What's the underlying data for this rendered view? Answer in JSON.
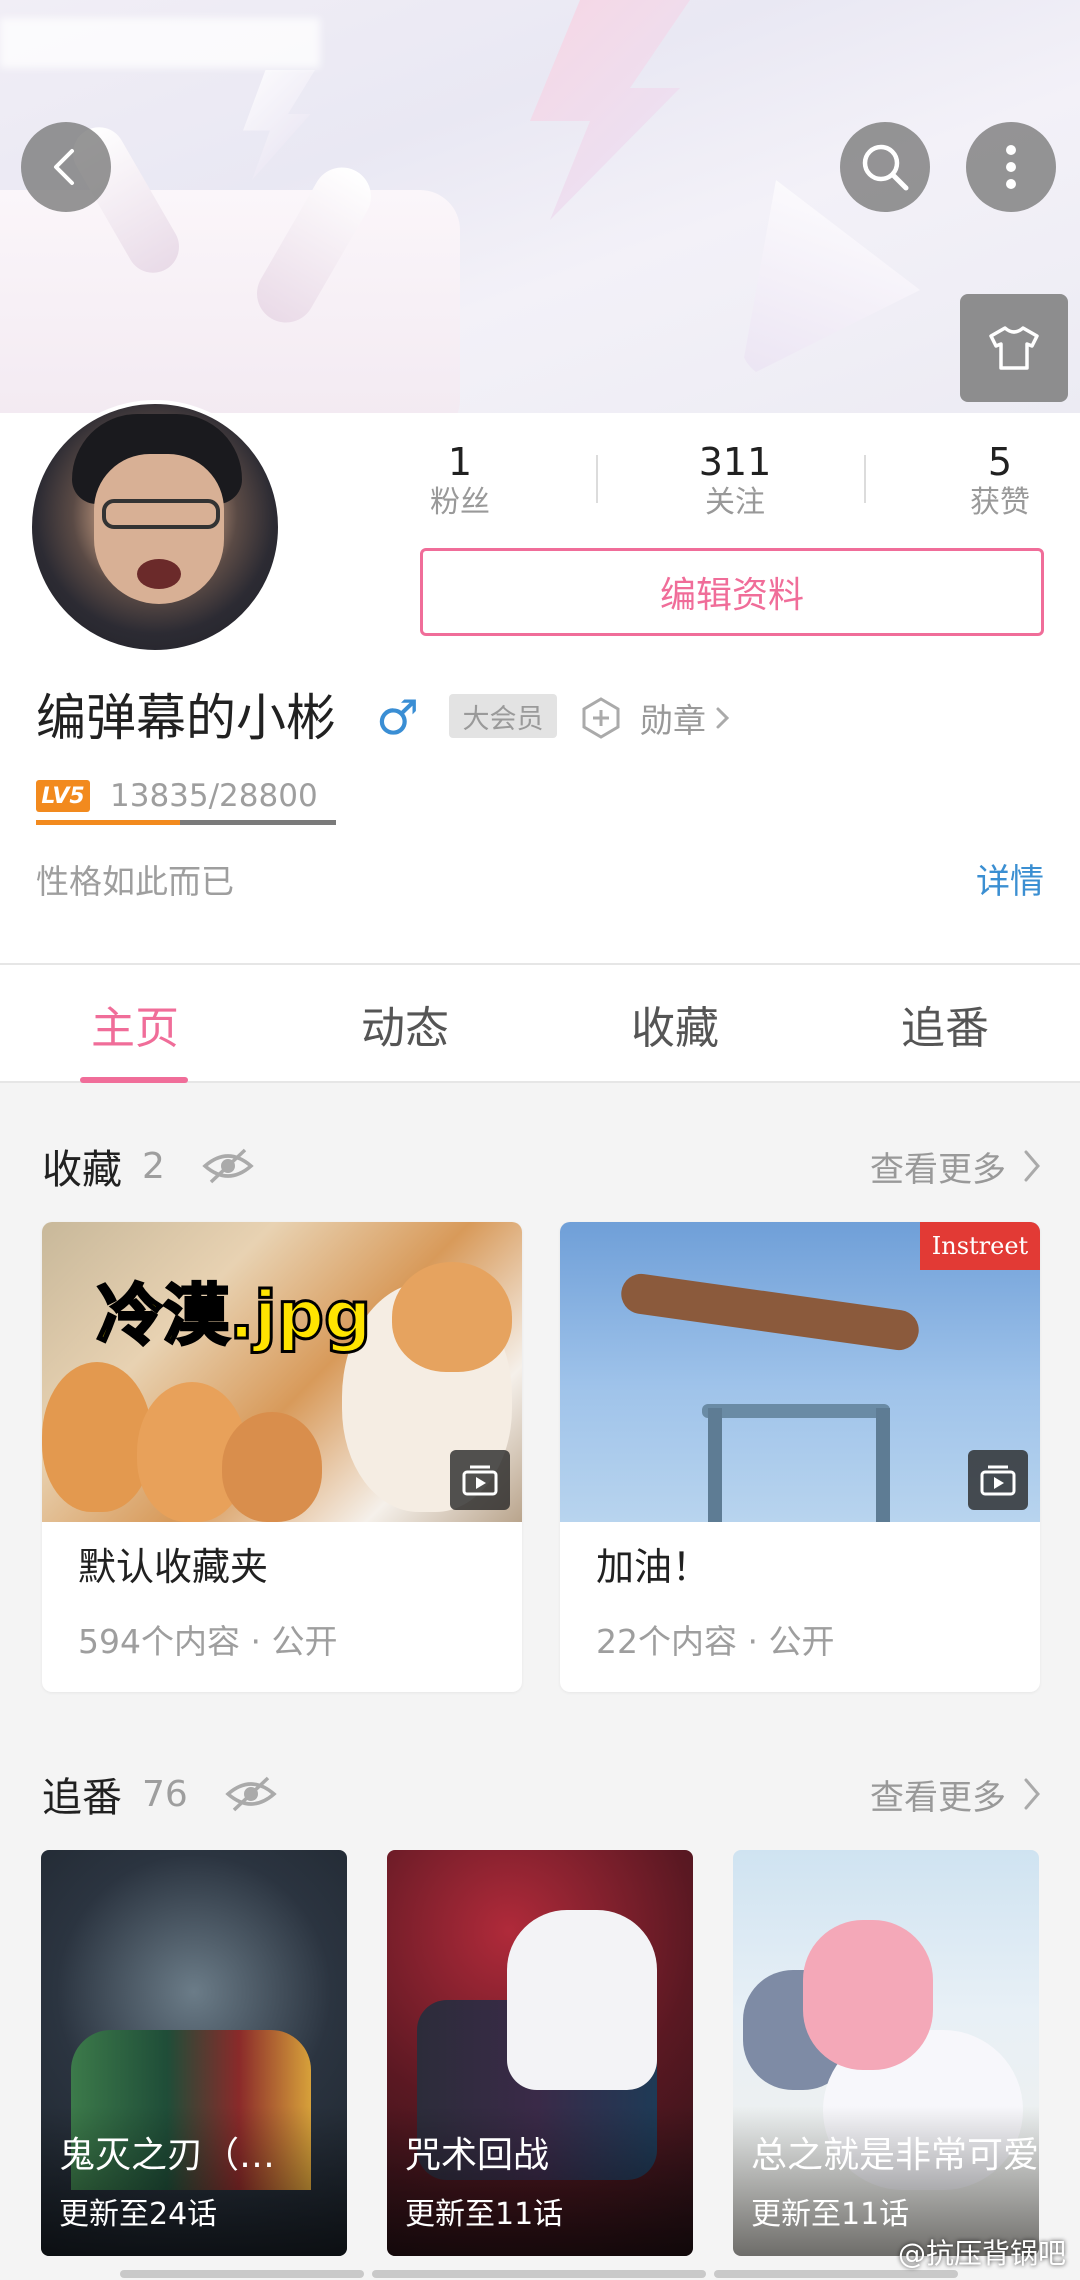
{
  "header": {
    "back_icon": "back-arrow-icon",
    "search_icon": "search-icon",
    "more_icon": "more-vertical-icon",
    "dress_icon": "tshirt-icon"
  },
  "stats": [
    {
      "value": "1",
      "label": "粉丝"
    },
    {
      "value": "311",
      "label": "关注"
    },
    {
      "value": "5",
      "label": "获赞"
    }
  ],
  "profile": {
    "edit_label": "编辑资料",
    "username": "编弹幕的小彬",
    "gender_symbol": "♂",
    "vip_label": "大会员",
    "medal_label": "勋章",
    "level_tag": "LV5",
    "exp_text": "13835/28800",
    "exp_fraction": 0.48,
    "bio": "性格如此而已",
    "detail_label": "详情"
  },
  "tabs": [
    {
      "label": "主页",
      "active": true
    },
    {
      "label": "动态",
      "active": false
    },
    {
      "label": "收藏",
      "active": false
    },
    {
      "label": "追番",
      "active": false
    }
  ],
  "favorites": {
    "title": "收藏",
    "count": "2",
    "more_label": "查看更多",
    "items": [
      {
        "name": "默认收藏夹",
        "meta": "594个内容 · 公开",
        "thumb_text": "冷漠.jpg"
      },
      {
        "name": "加油！",
        "meta": "22个内容 · 公开",
        "thumb_text": "Instreet"
      }
    ]
  },
  "bangumi": {
    "title": "追番",
    "count": "76",
    "more_label": "查看更多",
    "items": [
      {
        "name": "鬼灭之刃（…",
        "update": "更新至24话"
      },
      {
        "name": "咒术回战",
        "update": "更新至11话"
      },
      {
        "name": "总之就是非常可爱",
        "update": "更新至11话"
      }
    ]
  },
  "watermark": "@抗压背锅吧",
  "colors": {
    "accent": "#f06d99",
    "link": "#3b8fd2",
    "level": "#f28a1e"
  }
}
